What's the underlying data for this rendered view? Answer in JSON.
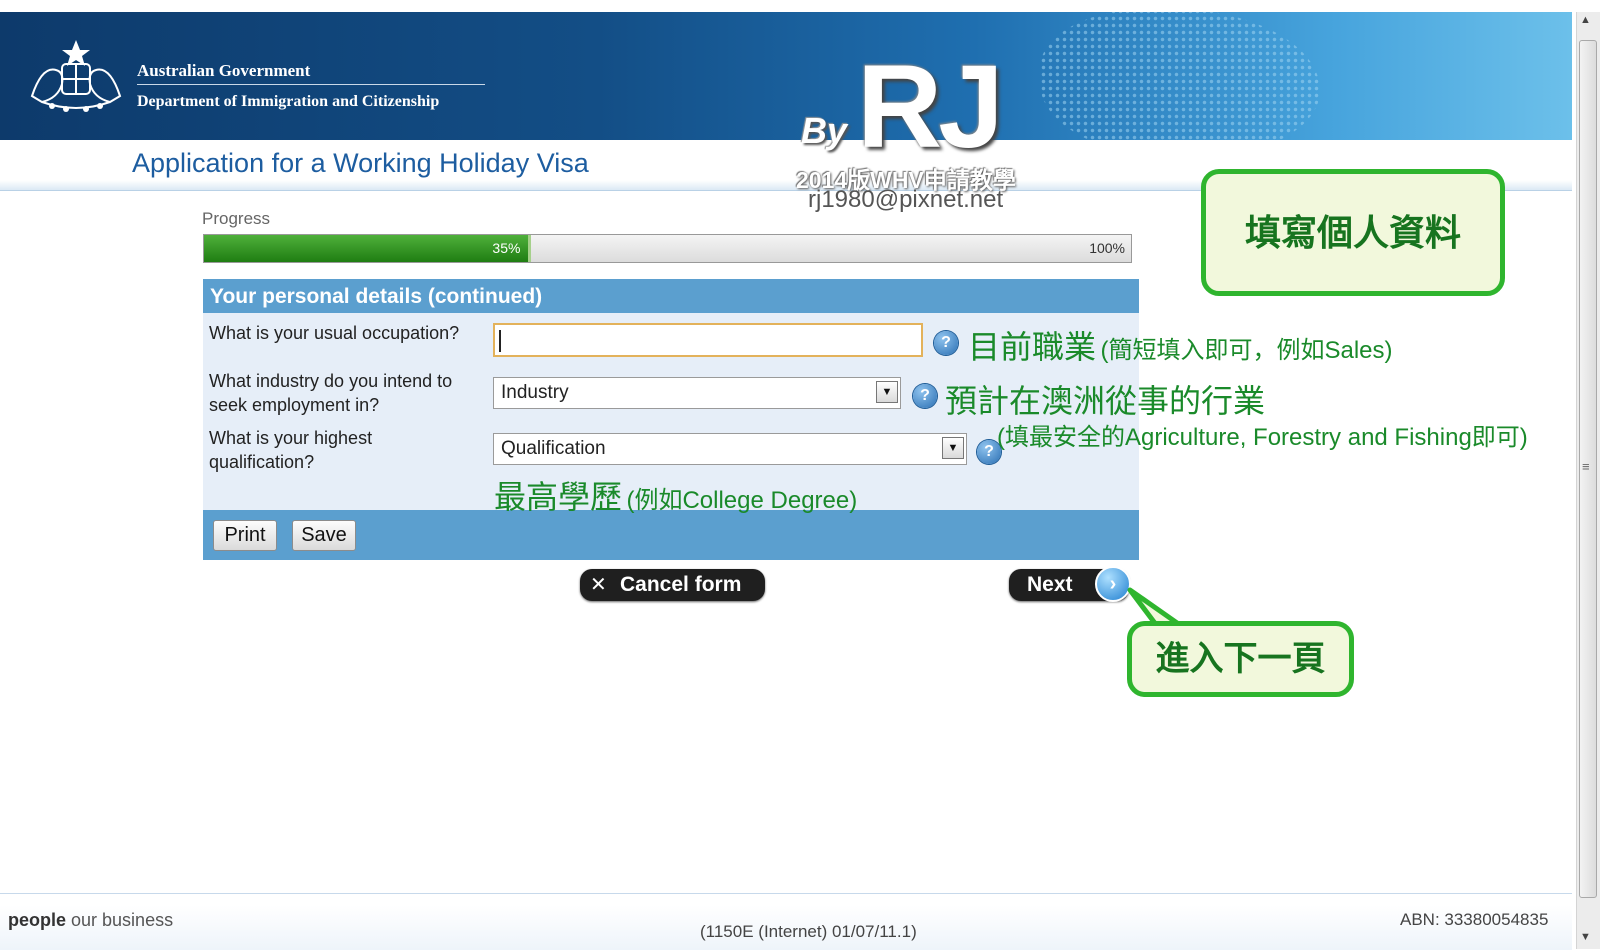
{
  "header": {
    "gov_name": "Australian Government",
    "dept_name": "Department of Immigration and Citizenship",
    "page_title": "Application for a Working Holiday Visa"
  },
  "watermark": {
    "by": "By",
    "rj": "RJ",
    "subtitle": "2014版WHV申請教學",
    "email": "rj1980@pixnet.net"
  },
  "progress": {
    "label": "Progress",
    "current": "35%",
    "max": "100%",
    "value": 0.35
  },
  "form": {
    "section_title": "Your personal details (continued)",
    "occupation": {
      "question": "What is your usual occupation?",
      "value": ""
    },
    "industry": {
      "question_line1": "What industry do you intend to",
      "question_line2": "seek employment in?",
      "selected": "Industry"
    },
    "qualification": {
      "question_line1": "What is your highest",
      "question_line2": "qualification?",
      "selected": "Qualification"
    },
    "print_label": "Print",
    "save_label": "Save",
    "help_glyph": "?"
  },
  "nav": {
    "cancel_label": "Cancel form",
    "cancel_glyph": "✕",
    "next_label": "Next"
  },
  "annotations": {
    "occupation_main": "目前職業",
    "occupation_note": "(簡短填入即可，例如Sales)",
    "industry_main": "預計在澳洲從事的行業",
    "industry_note": "(填最安全的Agriculture, Forestry and Fishing即可)",
    "qualification_main": "最高學歷",
    "qualification_note": "(例如College Degree)",
    "callout_top": "填寫個人資料",
    "callout_next": "進入下一頁"
  },
  "footer": {
    "tagline_bold": "people",
    "tagline_rest": " our business",
    "version": "(1150E (Internet) 01/07/11.1)",
    "abn": "ABN: 33380054835"
  },
  "colors": {
    "banner_dark": "#0d3a6b",
    "panel_blue": "#5b9fcf",
    "progress_green": "#2d8f1e",
    "annotation_green": "#1a8a2a"
  },
  "icons": [
    "coat-of-arms-icon",
    "help-icon",
    "dropdown-arrow-icon",
    "close-icon",
    "arrow-right-icon",
    "scroll-up-icon",
    "scroll-down-icon"
  ]
}
